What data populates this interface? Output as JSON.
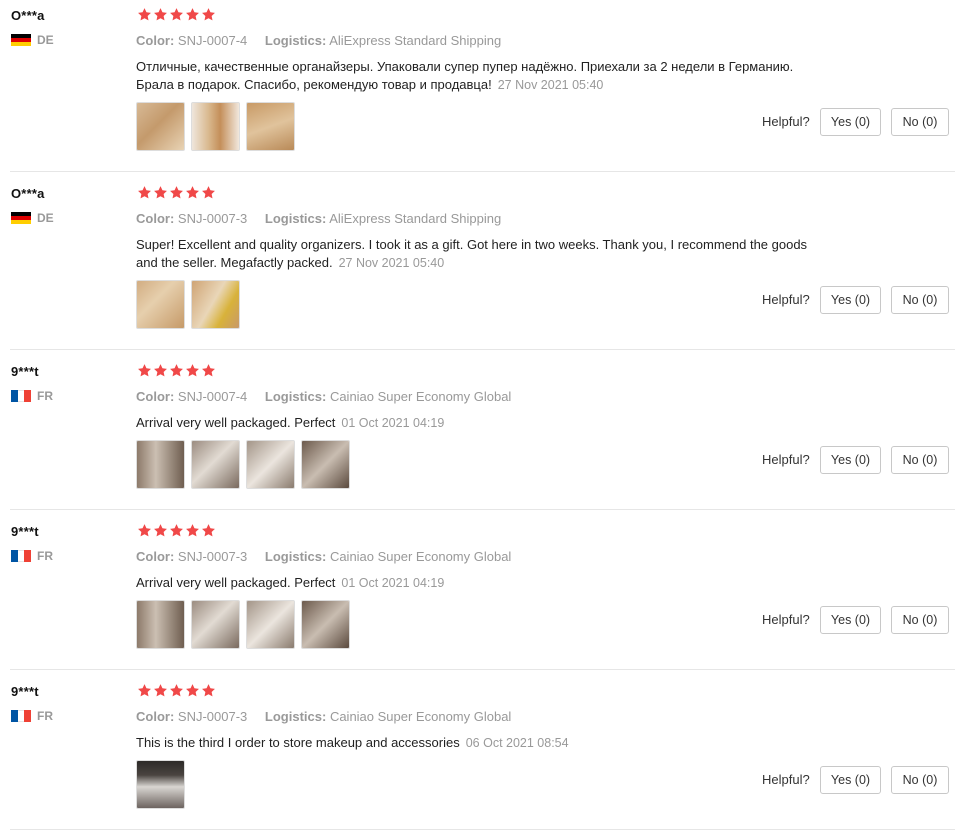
{
  "colors": {
    "star": "#f04848",
    "meta_text": "#999999",
    "divider": "#e6e6e6"
  },
  "labels": {
    "color": "Color:",
    "logistics": "Logistics:",
    "helpful": "Helpful?"
  },
  "reviews": [
    {
      "user": "O***a",
      "country": "DE",
      "flag": "germany-flag-icon",
      "rating": 5,
      "color": "SNJ-0007-4",
      "logistics": "AliExpress Standard Shipping",
      "text_lines": [
        "Отличные, качественные органайзеры. Упаковали супер пупер надёжно. Приехали за 2 недели в Германию.",
        "Брала в подарок. Спасибо, рекомендую товар и продавца!"
      ],
      "date": "27 Nov 2021 05:40",
      "photo_count": 3,
      "yes": "Yes (0)",
      "no": "No (0)"
    },
    {
      "user": "O***a",
      "country": "DE",
      "flag": "germany-flag-icon",
      "rating": 5,
      "color": "SNJ-0007-3",
      "logistics": "AliExpress Standard Shipping",
      "text_lines": [
        "Super! Excellent and quality organizers. I took it as a gift. Got here in two weeks. Thank you, I recommend the goods",
        "and the seller. Megafactly packed."
      ],
      "date": "27 Nov 2021 05:40",
      "photo_count": 2,
      "yes": "Yes (0)",
      "no": "No (0)"
    },
    {
      "user": "9***t",
      "country": "FR",
      "flag": "france-flag-icon",
      "rating": 5,
      "color": "SNJ-0007-4",
      "logistics": "Cainiao Super Economy Global",
      "text_lines": [
        "Arrival very well packaged. Perfect"
      ],
      "date": "01 Oct 2021 04:19",
      "photo_count": 4,
      "yes": "Yes (0)",
      "no": "No (0)"
    },
    {
      "user": "9***t",
      "country": "FR",
      "flag": "france-flag-icon",
      "rating": 5,
      "color": "SNJ-0007-3",
      "logistics": "Cainiao Super Economy Global",
      "text_lines": [
        "Arrival very well packaged. Perfect"
      ],
      "date": "01 Oct 2021 04:19",
      "photo_count": 4,
      "yes": "Yes (0)",
      "no": "No (0)"
    },
    {
      "user": "9***t",
      "country": "FR",
      "flag": "france-flag-icon",
      "rating": 5,
      "color": "SNJ-0007-3",
      "logistics": "Cainiao Super Economy Global",
      "text_lines": [
        "This is the third I order to store makeup and accessories"
      ],
      "date": "06 Oct 2021 08:54",
      "photo_count": 1,
      "yes": "Yes (0)",
      "no": "No (0)"
    }
  ]
}
